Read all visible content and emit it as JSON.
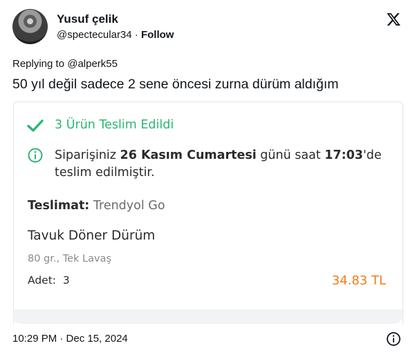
{
  "author": {
    "display_name": "Yusuf çelik",
    "handle": "@spectecular34",
    "separator": " · ",
    "follow_label": "Follow"
  },
  "platform_icon": "x-logo-icon",
  "reply": {
    "prefix": "Replying to ",
    "mention": "@alperk55"
  },
  "tweet_text": "50 yıl değil sadece 2 sene öncesi zurna dürüm aldığım",
  "order_card": {
    "status_icon": "check-icon",
    "status_text": "3 Ürün Teslim Edildi",
    "status_color": "#2bb673",
    "info_icon": "info-circle-icon",
    "message": {
      "part1": "Siparişiniz ",
      "date": "26 Kasım Cumartesi",
      "part2": " günü saat ",
      "time": "17:03",
      "part3": "'de teslim edilmiştir."
    },
    "delivery_label": "Teslimat:",
    "delivery_value": "Trendyol Go",
    "product_name": "Tavuk Döner Dürüm",
    "product_variant": "80 gr., Tek Lavaş",
    "quantity_label": "Adet:",
    "quantity_value": "3",
    "price": "34.83 TL",
    "price_color": "#f27a1a"
  },
  "footer": {
    "timestamp": "10:29 PM · Dec 15, 2024",
    "info_icon": "info-circle-icon"
  }
}
